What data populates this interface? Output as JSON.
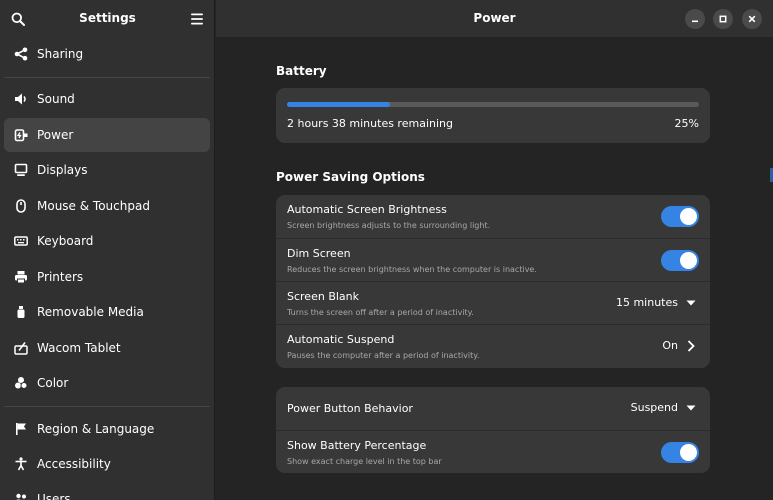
{
  "sidebar": {
    "title": "Settings",
    "search_icon": "search-icon",
    "menu_icon": "hamburger-menu-icon",
    "items": [
      {
        "label": "Sharing",
        "icon": "share-icon"
      },
      {
        "label": "Sound",
        "icon": "speaker-icon"
      },
      {
        "label": "Power",
        "icon": "power-plug-icon",
        "active": true
      },
      {
        "label": "Displays",
        "icon": "monitor-icon"
      },
      {
        "label": "Mouse & Touchpad",
        "icon": "mouse-icon"
      },
      {
        "label": "Keyboard",
        "icon": "keyboard-icon"
      },
      {
        "label": "Printers",
        "icon": "printer-icon"
      },
      {
        "label": "Removable Media",
        "icon": "usb-icon"
      },
      {
        "label": "Wacom Tablet",
        "icon": "tablet-icon"
      },
      {
        "label": "Color",
        "icon": "color-palette-icon"
      },
      {
        "label": "Region & Language",
        "icon": "flag-icon"
      },
      {
        "label": "Accessibility",
        "icon": "accessibility-icon"
      },
      {
        "label": "Users",
        "icon": "users-icon"
      }
    ]
  },
  "header": {
    "title": "Power",
    "minimize_icon": "minimize-icon",
    "maximize_icon": "maximize-icon",
    "close_icon": "close-icon"
  },
  "battery": {
    "section_title": "Battery",
    "remaining_text": "2 hours 38 minutes remaining",
    "percent_text": "25%",
    "level": 0.25
  },
  "power_saving": {
    "section_title": "Power Saving Options",
    "rows": [
      {
        "title": "Automatic Screen Brightness",
        "subtitle": "Screen brightness adjusts to the surrounding light.",
        "control": "switch",
        "on": true
      },
      {
        "title": "Dim Screen",
        "subtitle": "Reduces the screen brightness when the computer is inactive.",
        "control": "switch",
        "on": true
      },
      {
        "title": "Screen Blank",
        "subtitle": "Turns the screen off after a period of inactivity.",
        "control": "dropdown",
        "value": "15 minutes"
      },
      {
        "title": "Automatic Suspend",
        "subtitle": "Pauses the computer after a period of inactivity.",
        "control": "link",
        "value": "On"
      }
    ]
  },
  "general": {
    "rows": [
      {
        "title": "Power Button Behavior",
        "control": "dropdown",
        "value": "Suspend"
      },
      {
        "title": "Show Battery Percentage",
        "subtitle": "Show exact charge level in the top bar",
        "control": "switch",
        "on": true
      }
    ]
  },
  "colors": {
    "accent": "#3584e4",
    "window_bg": "#242424",
    "sidebar_bg": "#303030",
    "card_bg": "#383838"
  }
}
